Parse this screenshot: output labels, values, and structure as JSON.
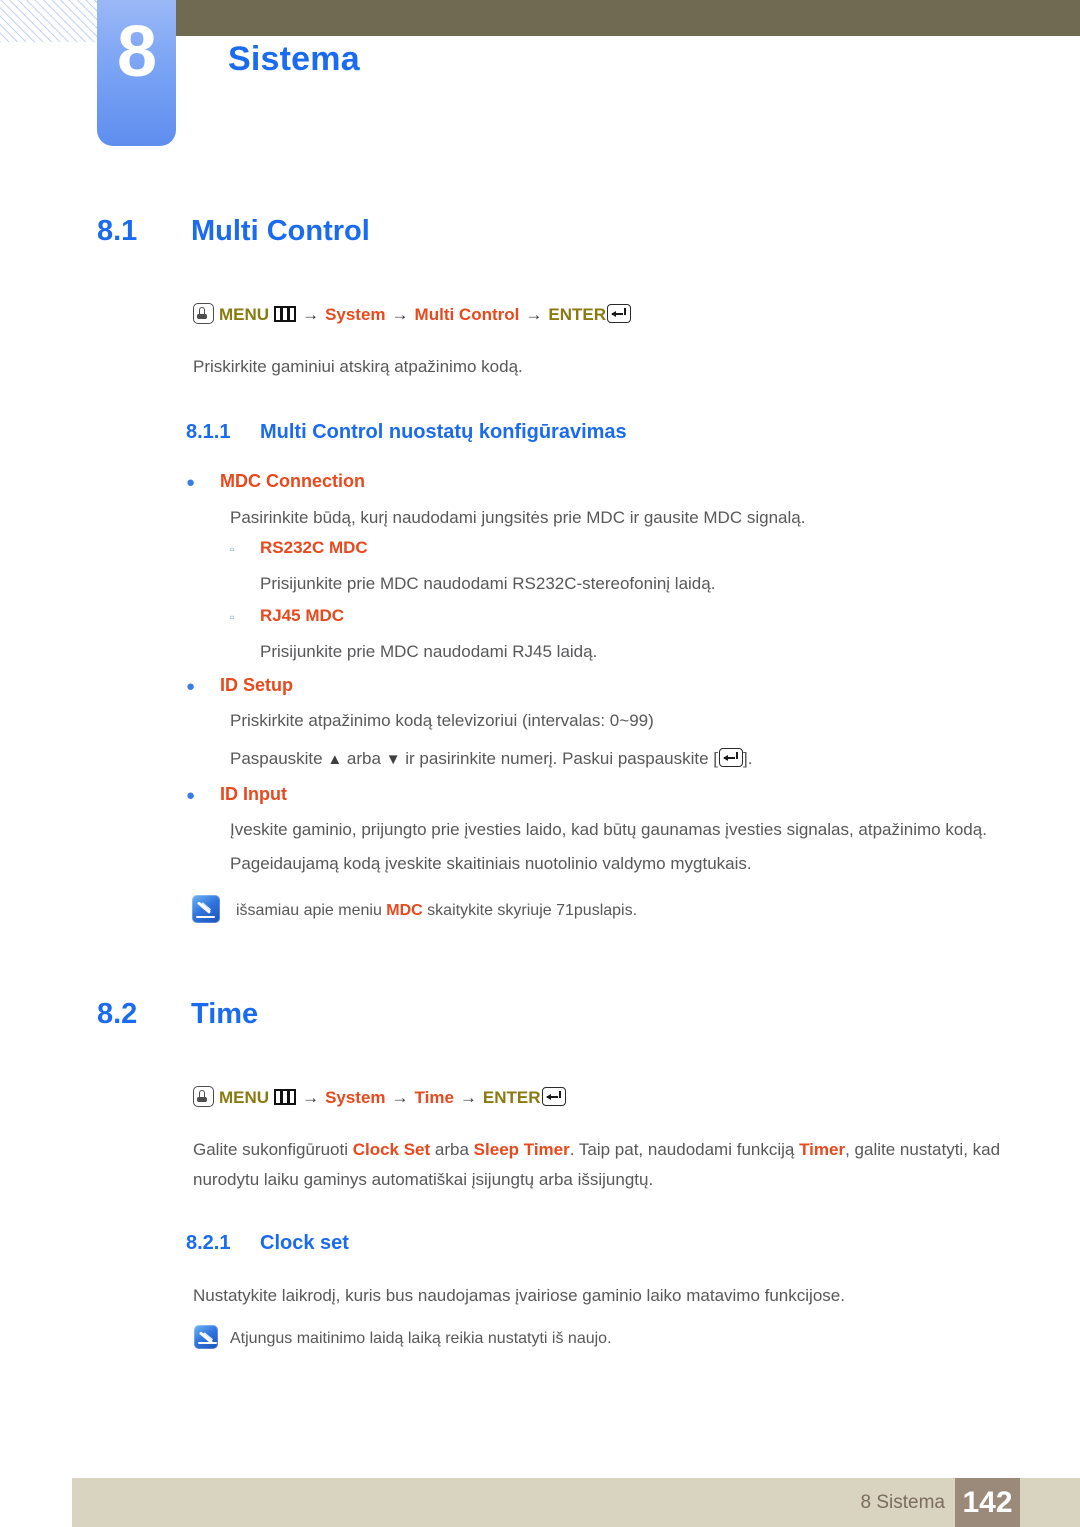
{
  "chapter": {
    "number": "8",
    "title": "Sistema"
  },
  "sections": {
    "multi_control": {
      "num": "8.1",
      "title": "Multi Control",
      "menu_path": {
        "press_icon": "press-hand-icon",
        "menu_label": "MENU",
        "menu_icon": "menu-grid-icon",
        "arrow": "→",
        "step1": "System",
        "step2": "Multi Control",
        "enter_label": "ENTER",
        "enter_icon": "enter-key-icon"
      },
      "intro": "Priskirkite gaminiui atskirą atpažinimo kodą.",
      "subsection": {
        "num": "8.1.1",
        "title": "Multi Control nuostatų konfigūravimas"
      },
      "items": [
        {
          "label": "MDC Connection",
          "desc": "Pasirinkite būdą, kurį naudodami jungsitės prie MDC ir gausite MDC signalą.",
          "subitems": [
            {
              "label": "RS232C MDC",
              "desc": "Prisijunkite prie MDC naudodami RS232C-stereofoninį laidą."
            },
            {
              "label": "RJ45 MDC",
              "desc": "Prisijunkite prie MDC naudodami RJ45 laidą."
            }
          ]
        },
        {
          "label": "ID Setup",
          "desc": "Priskirkite atpažinimo kodą televizoriui (intervalas: 0~99)",
          "desc2_a": "Paspauskite ",
          "up_arrow": "▲",
          "desc2_b": " arba ",
          "down_arrow": "▼",
          "desc2_c": " ir pasirinkite numerį. Paskui paspauskite [",
          "desc2_d": "]."
        },
        {
          "label": "ID Input",
          "desc": "Įveskite gaminio, prijungto prie įvesties laido, kad būtų gaunamas įvesties signalas, atpažinimo kodą.",
          "desc2": "Pageidaujamą kodą įveskite skaitiniais nuotolinio valdymo mygtukais."
        }
      ],
      "note": {
        "icon": "note-pencil-icon",
        "text_a": "išsamiau apie meniu ",
        "highlight": "MDC",
        "text_b": " skaitykite skyriuje 71puslapis."
      }
    },
    "time": {
      "num": "8.2",
      "title": "Time",
      "menu_path": {
        "press_icon": "press-hand-icon",
        "menu_label": "MENU",
        "menu_icon": "menu-grid-icon",
        "arrow": "→",
        "step1": "System",
        "step2": "Time",
        "enter_label": "ENTER",
        "enter_icon": "enter-key-icon"
      },
      "paragraph": {
        "p1": "Galite sukonfigūruoti ",
        "h1": "Clock Set",
        "p2": " arba ",
        "h2": "Sleep Timer",
        "p3": ". Taip pat, naudodami funkciją ",
        "h3": "Timer",
        "p4": ", galite nustatyti, kad nurodytu laiku gaminys automatiškai įsijungtų arba išsijungtų."
      },
      "subsection": {
        "num": "8.2.1",
        "title": "Clock set",
        "desc": "Nustatykite laikrodį, kuris bus naudojamas įvairiose gaminio laiko matavimo funkcijose.",
        "note": {
          "icon": "note-pencil-icon",
          "text": "Atjungus maitinimo laidą laiką reikia nustatyti iš naujo."
        }
      }
    }
  },
  "footer": {
    "label": "8 Sistema",
    "page": "142"
  },
  "colors": {
    "heading_blue": "#1a6bf0",
    "accent_orange": "#e8491d",
    "menu_olive": "#8a7a12",
    "topbar": "#706a52",
    "footer_bar": "#d9d4bf",
    "footer_page": "#9b8979"
  }
}
